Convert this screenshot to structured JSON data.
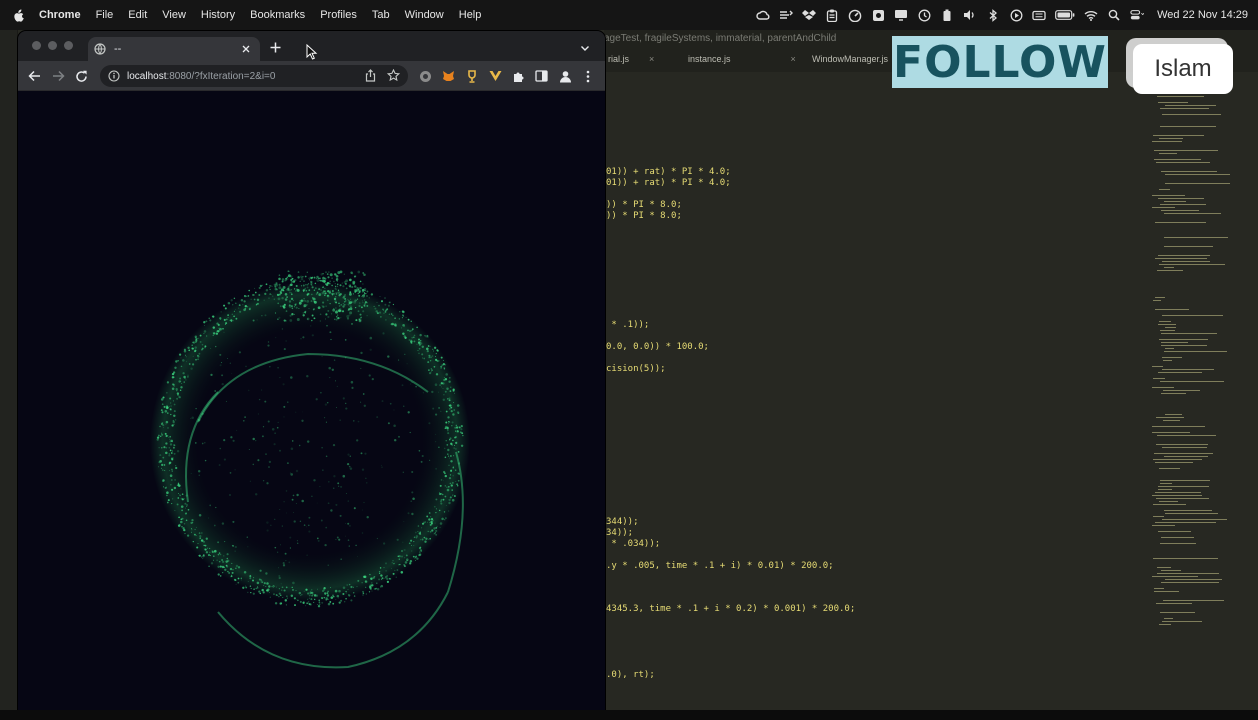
{
  "menubar": {
    "apple_icon": "apple-logo-icon",
    "app_name": "Chrome",
    "items": [
      "File",
      "Edit",
      "View",
      "History",
      "Bookmarks",
      "Profiles",
      "Tab",
      "Window",
      "Help"
    ],
    "clock": "Wed 22 Nov  14:29",
    "status_icons": [
      "creative-cloud-icon",
      "bartender-icon",
      "dropbox-icon",
      "clipboard-icon",
      "speedometer-icon",
      "screenshot-icon",
      "display-icon",
      "time-machine-icon",
      "battery-app-icon",
      "volume-icon",
      "bluetooth-icon",
      "play-icon",
      "keyboard-icon",
      "battery-icon",
      "wifi-icon",
      "spotlight-search-icon",
      "control-center-icon"
    ]
  },
  "browser": {
    "tab_title": "--",
    "url_host": "localhost",
    "url_rest": ":8080/?fxIteration=2&i=0",
    "colors": {
      "toolbar": "#35363a",
      "tabstrip": "#202124",
      "viewport": "#060614",
      "particles": "#3ddc84"
    }
  },
  "editor": {
    "path": "ageTest, fragileSystems, immaterial, parentAndChild",
    "tabs": [
      "rial.js",
      "instance.js",
      "WindowManager.js"
    ],
    "code_lines": [
      {
        "text": "01)) + rat) * PI * 4.0;"
      },
      {
        "text": "01)) + rat) * PI * 4.0;"
      },
      {
        "text": ")) * PI * 8.0;"
      },
      {
        "text": ")) * PI * 8.0;"
      },
      {
        "text": " * .1));"
      },
      {
        "text": "0.0, 0.0)) * 100.0;"
      },
      {
        "text": "cision(5));"
      },
      {
        "text": "344));"
      },
      {
        "text": "34));"
      },
      {
        "text": " * .034));"
      },
      {
        "text": ".y * .005, time * .1 + i) * 0.01) * 200.0;"
      },
      {
        "text": "4345.3, time * .1 + i * 0.2) * 0.001) * 200.0;"
      },
      {
        "text": ".0), rt);"
      }
    ]
  },
  "overlay": {
    "follow_logo": "FOLLOW",
    "name_card": "Islam"
  }
}
